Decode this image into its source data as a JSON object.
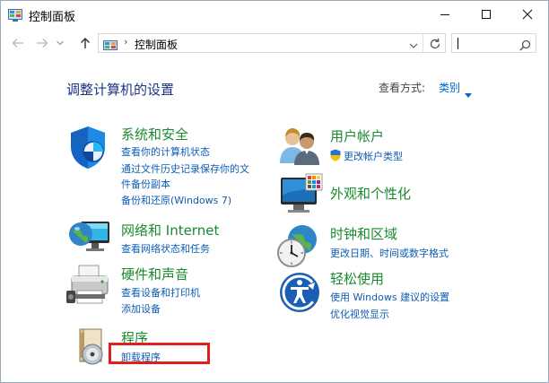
{
  "window": {
    "title": "控制面板"
  },
  "address": {
    "separator": "›",
    "path": "控制面板"
  },
  "header": {
    "heading": "调整计算机的设置",
    "view_by_label": "查看方式:",
    "view_by_value": "类别"
  },
  "categories": [
    {
      "title": "系统和安全",
      "links": [
        "查看你的计算机状态",
        "通过文件历史记录保存你的文",
        "件备份副本",
        "备份和还原(Windows 7)"
      ]
    },
    {
      "title": "网络和 Internet",
      "links": [
        "查看网络状态和任务"
      ]
    },
    {
      "title": "硬件和声音",
      "links": [
        "查看设备和打印机",
        "添加设备"
      ]
    },
    {
      "title": "程序",
      "links": [
        "卸载程序"
      ]
    },
    {
      "title": "用户帐户",
      "links": [
        "更改帐户类型"
      ]
    },
    {
      "title": "外观和个性化",
      "links": []
    },
    {
      "title": "时钟和区域",
      "links": [
        "更改日期、时间或数字格式"
      ]
    },
    {
      "title": "轻松使用",
      "links": [
        "使用 Windows 建议的设置",
        "优化视觉显示"
      ]
    }
  ],
  "colors": {
    "link": "#0d5cb6",
    "category_title": "#1a8a2f",
    "heading": "#1e3287",
    "highlight_box": "#e0201d"
  }
}
